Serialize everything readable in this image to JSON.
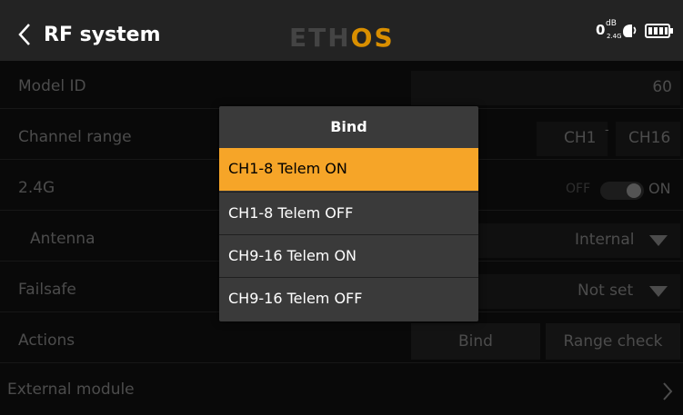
{
  "header": {
    "title": "RF system",
    "logo_main": "ETH",
    "logo_accent": "OS",
    "rssi_value": "0",
    "rssi_unit": "dB",
    "rssi_band": "2.4G"
  },
  "rows": {
    "model_id": {
      "label": "Model ID",
      "value": "60"
    },
    "channel_range": {
      "label": "Channel range",
      "start": "CH1",
      "separator": "-",
      "end": "CH16"
    },
    "band": {
      "label": "2.4G",
      "off_label": "OFF",
      "on_label": "ON",
      "state": "on"
    },
    "antenna": {
      "label": "Antenna",
      "value": "Internal"
    },
    "failsafe": {
      "label": "Failsafe",
      "value": "Not set"
    },
    "actions": {
      "label": "Actions",
      "bind_label": "Bind",
      "range_check_label": "Range check"
    },
    "external_module": {
      "label": "External module"
    }
  },
  "modal": {
    "title": "Bind",
    "options": [
      "CH1-8 Telem ON",
      "CH1-8 Telem OFF",
      "CH9-16 Telem ON",
      "CH9-16 Telem OFF"
    ],
    "selected_index": 0
  },
  "colors": {
    "accent": "#f6a528",
    "background": "#111111",
    "header": "#232323",
    "modal": "#3a3a3a",
    "dim_text": "#8a8a8a"
  },
  "icons": {
    "back": "chevron-left-icon",
    "dropdown": "triangle-down-icon",
    "next": "chevron-right-icon",
    "receiver": "receiver-icon",
    "battery": "battery-icon"
  }
}
